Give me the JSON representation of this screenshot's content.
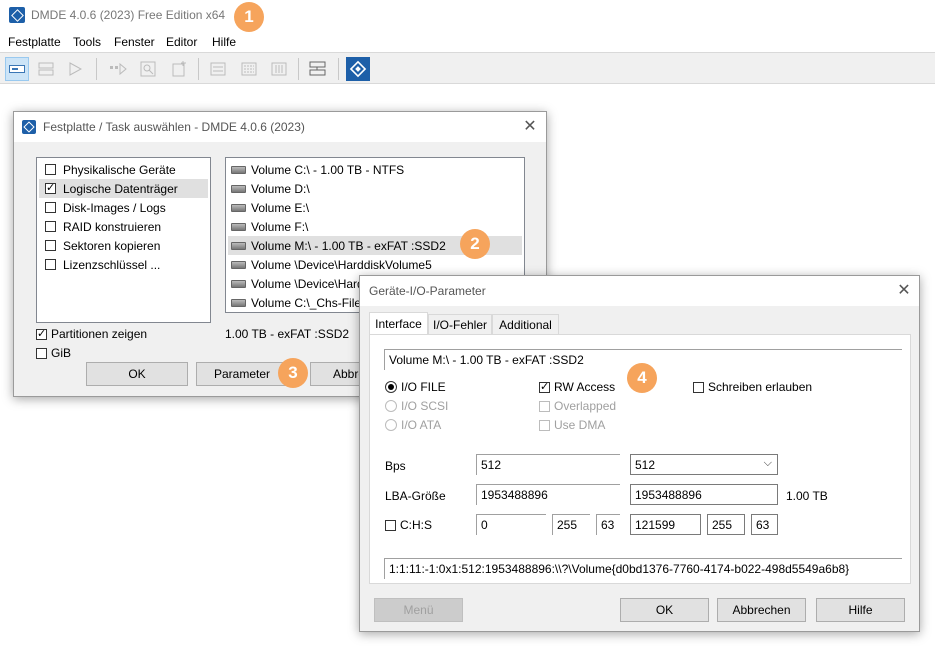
{
  "app": {
    "title": "DMDE 4.0.6 (2023) Free Edition x64"
  },
  "menu": [
    "Festplatte",
    "Tools",
    "Fenster",
    "Editor",
    "Hilfe"
  ],
  "badges": [
    "1",
    "2",
    "3",
    "4"
  ],
  "task_dialog": {
    "title": "Festplatte / Task auswählen - DMDE 4.0.6 (2023)",
    "tasks": [
      {
        "label": "Physikalische Geräte",
        "checked": false
      },
      {
        "label": "Logische Datenträger",
        "checked": true,
        "selected": true
      },
      {
        "label": "Disk-Images / Logs",
        "checked": false
      },
      {
        "label": "RAID konstruieren",
        "checked": false
      },
      {
        "label": "Sektoren kopieren",
        "checked": false
      },
      {
        "label": "Lizenzschlüssel ...",
        "checked": false
      }
    ],
    "volumes": [
      {
        "label": "Volume C:\\ - 1.00 TB - NTFS"
      },
      {
        "label": "Volume D:\\"
      },
      {
        "label": "Volume E:\\"
      },
      {
        "label": "Volume F:\\"
      },
      {
        "label": "Volume M:\\ - 1.00 TB - exFAT :SSD2",
        "selected": true
      },
      {
        "label": "Volume \\Device\\HarddiskVolume5"
      },
      {
        "label": "Volume \\Device\\HarddiskVolume6"
      },
      {
        "label": "Volume C:\\_Chs-Files"
      }
    ],
    "show_partitions": "Partitionen zeigen",
    "gib": "GiB",
    "status": "1.00 TB - exFAT :SSD2",
    "ok": "OK",
    "parameter": "Parameter",
    "cancel": "Abbrechen"
  },
  "io_dialog": {
    "title": "Geräte-I/O-Parameter",
    "tabs": [
      "Interface",
      "I/O-Fehler",
      "Additional"
    ],
    "device": "Volume M:\\ - 1.00 TB - exFAT :SSD2",
    "io_file": "I/O FILE",
    "io_scsi": "I/O SCSI",
    "io_ata": "I/O ATA",
    "rw_access": "RW Access",
    "overlapped": "Overlapped",
    "use_dma": "Use DMA",
    "allow_write": "Schreiben erlauben",
    "bps_label": "Bps",
    "bps_value": "512",
    "bps_select": "512",
    "lba_label": "LBA-Größe",
    "lba_value": "1953488896",
    "lba_value2": "1953488896",
    "lba_size": "1.00 TB",
    "chs_label": "C:H:S",
    "chs_c": "0",
    "chs_h": "255",
    "chs_s": "63",
    "chs_c2": "121599",
    "chs_h2": "255",
    "chs_s2": "63",
    "path": "1:1:11:-1:0x1:512:1953488896:\\\\?\\Volume{d0bd1376-7760-4174-b022-498d5549a6b8}",
    "menu_btn": "Menü",
    "ok": "OK",
    "cancel": "Abbrechen",
    "help": "Hilfe"
  }
}
